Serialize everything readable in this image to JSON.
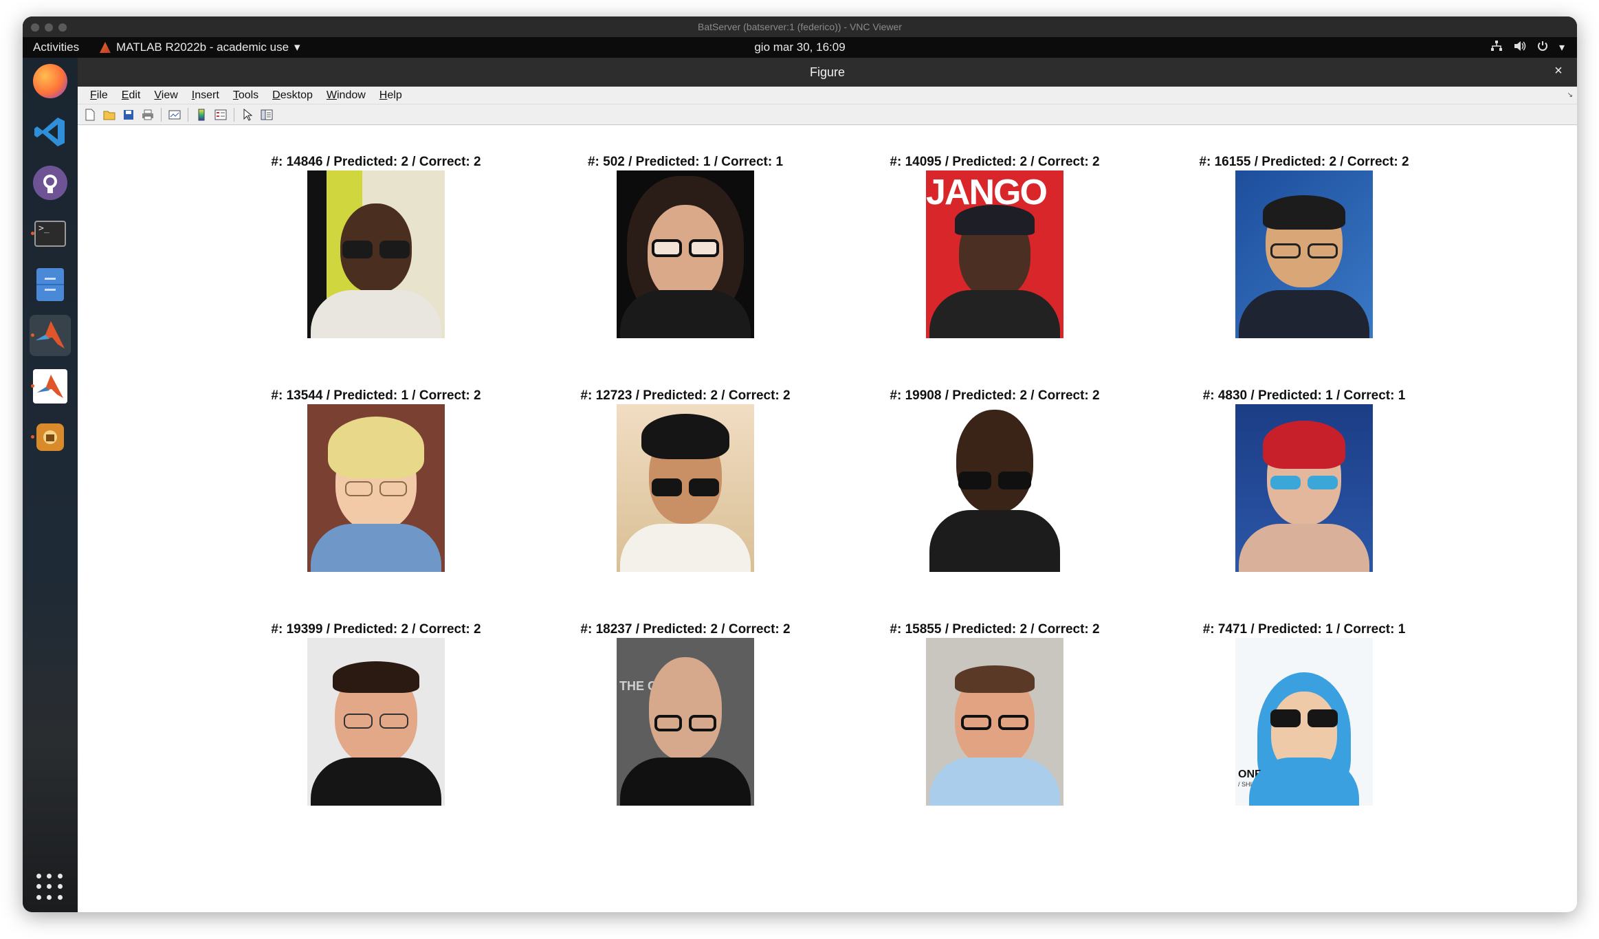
{
  "vnc_window": {
    "title": "BatServer (batserver:1 (federico)) - VNC Viewer"
  },
  "gnome_bar": {
    "activities": "Activities",
    "app_label": "MATLAB R2022b - academic use",
    "clock": "gio mar 30, 16:09"
  },
  "dock": {
    "items": [
      "firefox-icon",
      "vscode-icon",
      "github-icon",
      "terminal-icon",
      "files-icon",
      "matlab-icon",
      "matlab-launcher-icon",
      "installer-icon"
    ],
    "apps_grid": "show-applications-icon"
  },
  "figure": {
    "title": "Figure",
    "close": "×",
    "menus": [
      "File",
      "Edit",
      "View",
      "Insert",
      "Tools",
      "Desktop",
      "Window",
      "Help"
    ],
    "toolbar": [
      "new-figure-icon",
      "open-icon",
      "save-icon",
      "print-icon",
      "link-plot-icon",
      "colorbar-icon",
      "legend-icon",
      "pointer-icon",
      "property-inspector-icon"
    ]
  },
  "grid": {
    "rows": [
      [
        {
          "title": "#: 14846 / Predicted: 2 / Correct: 2",
          "image": "face-wyclef"
        },
        {
          "title": "#: 502 / Predicted: 1 / Correct: 1",
          "image": "face-katey"
        },
        {
          "title": "#: 14095 / Predicted: 2 / Correct: 2",
          "image": "face-samuel"
        },
        {
          "title": "#: 16155 / Predicted: 2 / Correct: 2",
          "image": "face-patrick"
        }
      ],
      [
        {
          "title": "#: 13544 / Predicted: 1 / Correct: 2",
          "image": "face-blond-boy"
        },
        {
          "title": "#: 12723 / Predicted: 2 / Correct: 2",
          "image": "face-taylor"
        },
        {
          "title": "#: 19908 / Predicted: 2 / Correct: 2",
          "image": "face-nelly"
        },
        {
          "title": "#: 4830 / Predicted: 1 / Correct: 1",
          "image": "face-swimmer"
        }
      ],
      [
        {
          "title": "#: 19399 / Predicted: 2 / Correct: 2",
          "image": "face-patton"
        },
        {
          "title": "#: 18237 / Predicted: 2 / Correct: 2",
          "image": "face-soderbergh"
        },
        {
          "title": "#: 15855 / Predicted: 2 / Correct: 2",
          "image": "face-tom"
        },
        {
          "title": "#: 7471 / Predicted: 1 / Correct: 1",
          "image": "face-onew"
        }
      ]
    ],
    "image_text": {
      "django": "JANGO",
      "onew": "ONEW",
      "onew_sub": "/ SHINee",
      "the_c": "THE C"
    }
  }
}
